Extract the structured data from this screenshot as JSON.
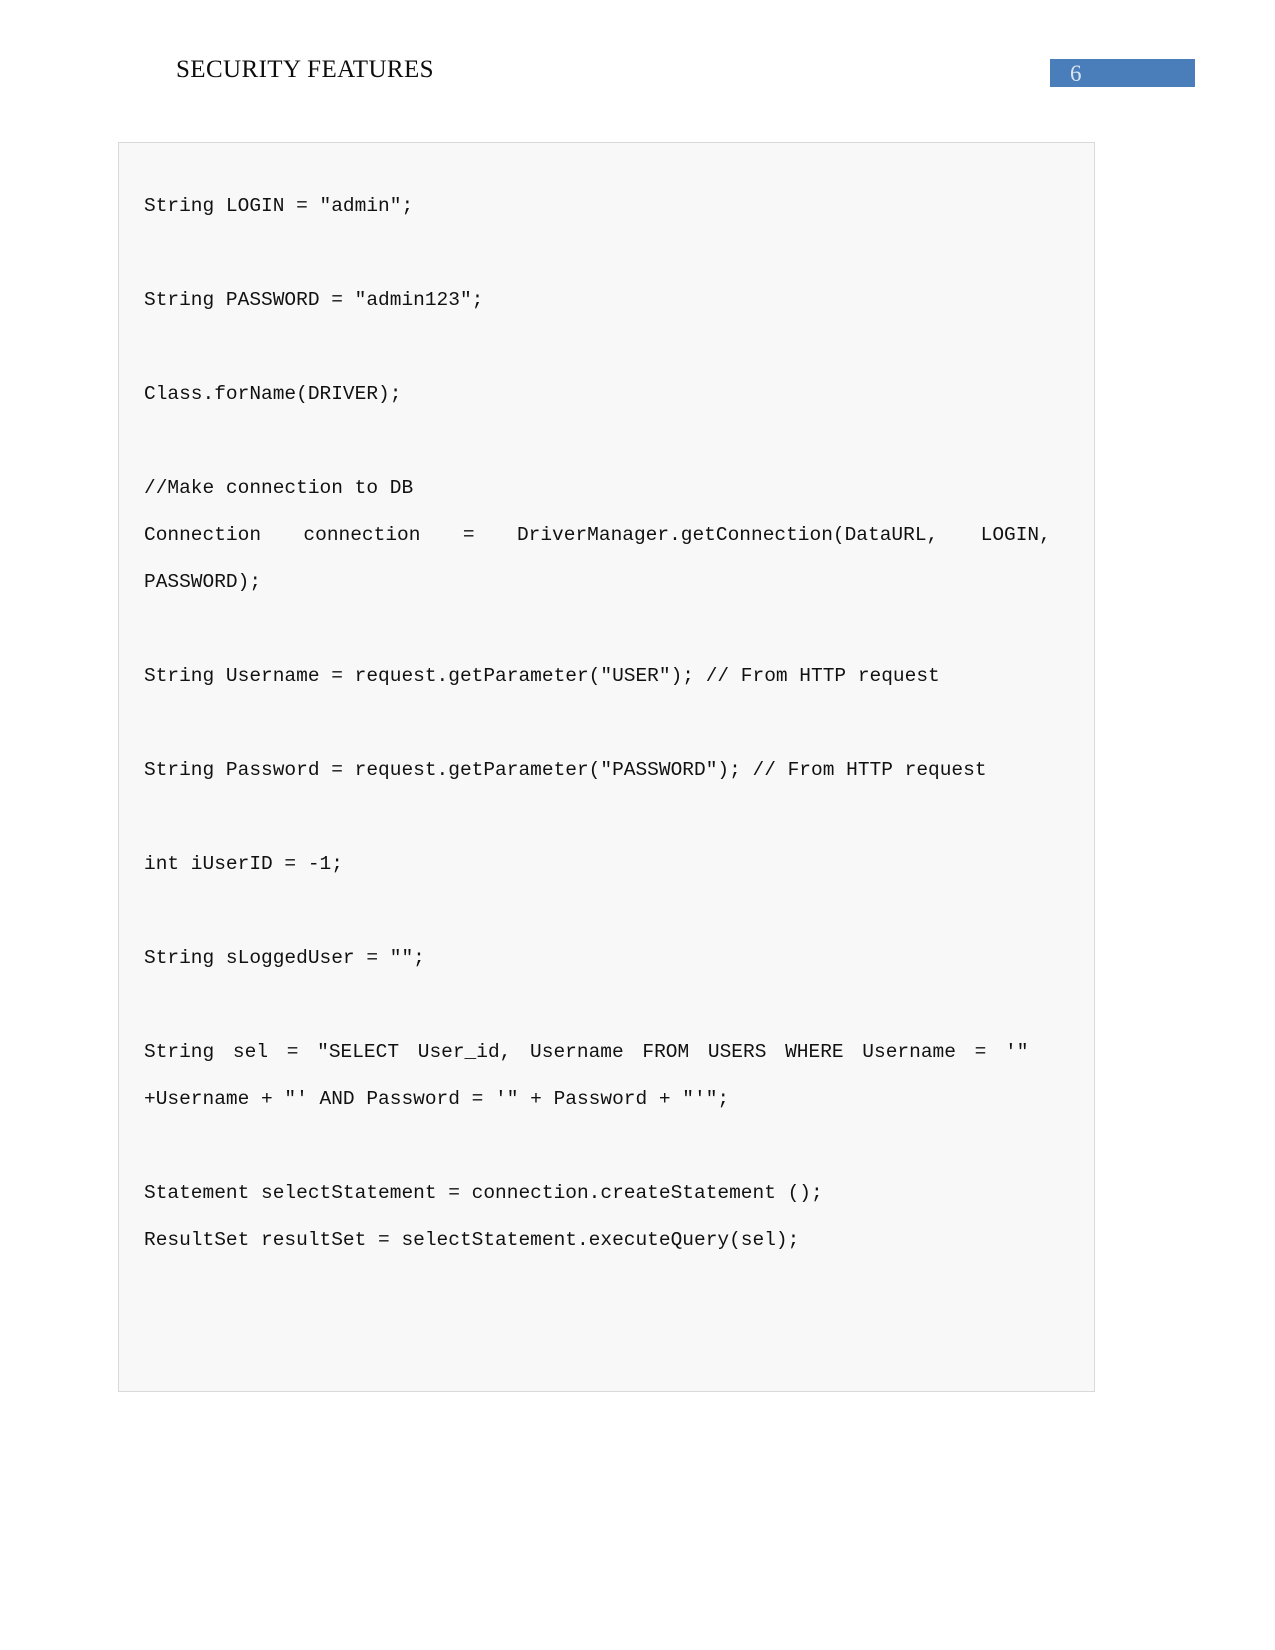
{
  "header": {
    "title": "SECURITY FEATURES",
    "page_number": "6",
    "accent_color": "#4a7ebb",
    "page_number_color": "#dce6f2"
  },
  "code_block": {
    "background_color": "#f8f8f8",
    "border_color": "#d9d9d9",
    "language": "java",
    "lines": [
      {
        "id": "l1",
        "text": "String LOGIN = \"admin\";"
      },
      {
        "id": "l2",
        "text": "String PASSWORD = \"admin123\";"
      },
      {
        "id": "l3",
        "text": "Class.forName(DRIVER);"
      },
      {
        "id": "l4",
        "text": "//Make connection to DB"
      },
      {
        "id": "l5a",
        "text": "Connection  connection  =  DriverManager.getConnection(DataURL,  LOGIN,"
      },
      {
        "id": "l5b",
        "text": "PASSWORD);"
      },
      {
        "id": "l6",
        "text": "String Username = request.getParameter(\"USER\"); // From HTTP request"
      },
      {
        "id": "l7",
        "text": "String Password = request.getParameter(\"PASSWORD\"); // From HTTP request"
      },
      {
        "id": "l8",
        "text": "int iUserID = -1;"
      },
      {
        "id": "l9",
        "text": "String sLoggedUser = \"\";"
      },
      {
        "id": "l10a",
        "text": "String sel = \"SELECT User_id, Username FROM USERS WHERE Username = '\""
      },
      {
        "id": "l10b",
        "text": "+Username + \"' AND Password = '\" + Password + \"'\";"
      },
      {
        "id": "l11",
        "text": "Statement selectStatement = connection.createStatement ();"
      },
      {
        "id": "l12",
        "text": "ResultSet resultSet = selectStatement.executeQuery(sel);"
      }
    ]
  }
}
